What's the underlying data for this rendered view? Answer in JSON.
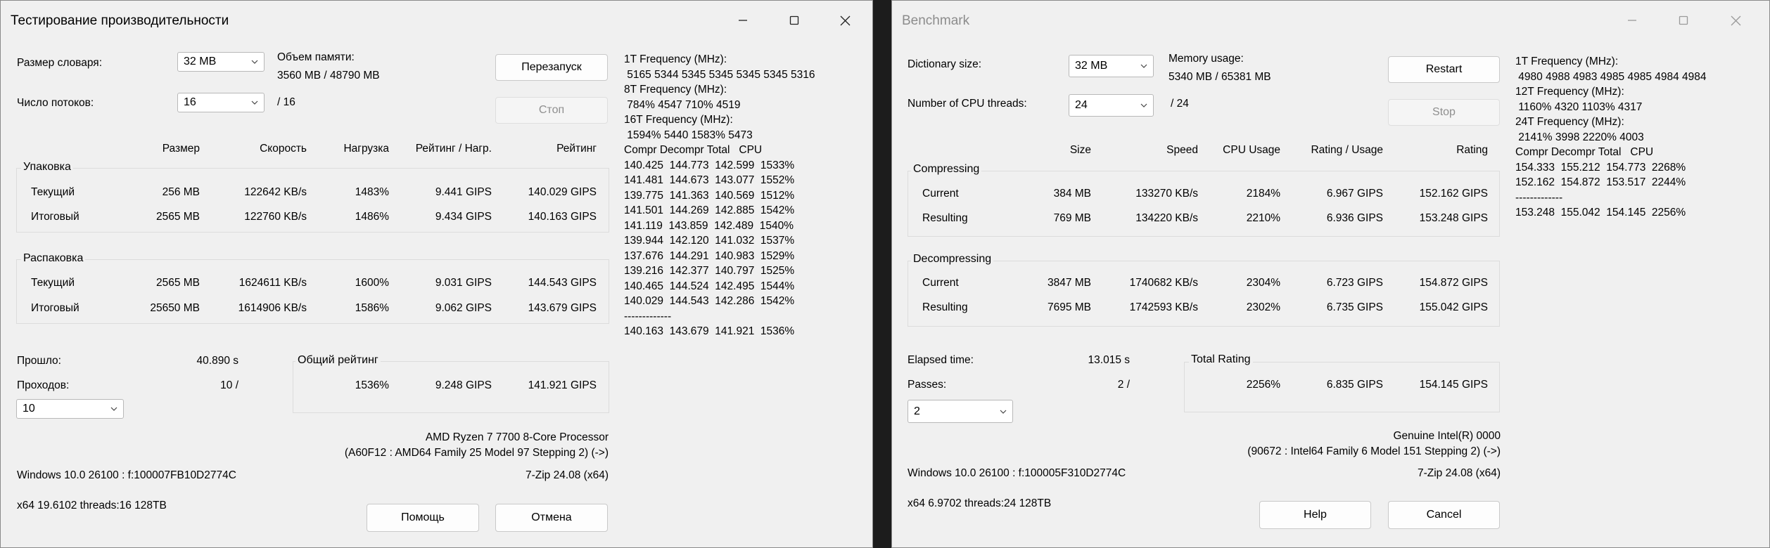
{
  "win1": {
    "title": "Тестирование производительности",
    "dict_label": "Размер словаря:",
    "dict_value": "32 MB",
    "mem_label": "Объем памяти:",
    "mem_value": "3560 MB / 48790 MB",
    "threads_label": "Число потоков:",
    "threads_value": "16",
    "threads_max": "/ 16",
    "restart": "Перезапуск",
    "stop": "Стоп",
    "headers": {
      "size": "Размер",
      "speed": "Скорость",
      "usage": "Нагрузка",
      "rpu": "Рейтинг / Нагр.",
      "rating": "Рейтинг"
    },
    "comp_title": "Упаковка",
    "decomp_title": "Распаковка",
    "comp_rows": [
      {
        "label": "Текущий",
        "size": "256 MB",
        "speed": "122642 KB/s",
        "usage": "1483%",
        "rpu": "9.441 GIPS",
        "rating": "140.029 GIPS"
      },
      {
        "label": "Итоговый",
        "size": "2565 MB",
        "speed": "122760 KB/s",
        "usage": "1486%",
        "rpu": "9.434 GIPS",
        "rating": "140.163 GIPS"
      }
    ],
    "decomp_rows": [
      {
        "label": "Текущий",
        "size": "2565 MB",
        "speed": "1624611 KB/s",
        "usage": "1600%",
        "rpu": "9.031 GIPS",
        "rating": "144.543 GIPS"
      },
      {
        "label": "Итоговый",
        "size": "25650 MB",
        "speed": "1614906 KB/s",
        "usage": "1586%",
        "rpu": "9.062 GIPS",
        "rating": "143.679 GIPS"
      }
    ],
    "elapsed_label": "Прошло:",
    "elapsed_value": "40.890 s",
    "passes_label": "Проходов:",
    "passes_value": "10 /",
    "passes_select": "10",
    "total_title": "Общий рейтинг",
    "total": {
      "usage": "1536%",
      "rpu": "9.248 GIPS",
      "rating": "141.921 GIPS"
    },
    "cpu_name": "AMD Ryzen 7 7700 8-Core Processor",
    "cpu_id": "(A60F12 : AMD64 Family 25 Model 97 Stepping 2) (->)",
    "os": "Windows 10.0 26100 :  f:100007FB10D2774C",
    "version": "7-Zip 24.08 (x64)",
    "arch": "x64 19.6102 threads:16 128TB",
    "help": "Помощь",
    "cancel": "Отмена",
    "side": "1T Frequency (MHz):\n 5165 5344 5345 5345 5345 5345 5316\n8T Frequency (MHz):\n 784% 4547 710% 4519\n16T Frequency (MHz):\n 1594% 5440 1583% 5473\nCompr Decompr Total   CPU\n140.425  144.773  142.599  1533%\n141.481  144.673  143.077  1552%\n139.775  141.363  140.569  1512%\n141.501  144.269  142.885  1542%\n141.119  143.859  142.489  1540%\n139.944  142.120  141.032  1537%\n137.676  144.291  140.983  1529%\n139.216  142.377  140.797  1525%\n140.465  144.524  142.495  1544%\n140.029  144.543  142.286  1542%\n-------------\n140.163  143.679  141.921  1536%"
  },
  "win2": {
    "title": "Benchmark",
    "dict_label": "Dictionary size:",
    "dict_value": "32 MB",
    "mem_label": "Memory usage:",
    "mem_value": "5340 MB / 65381 MB",
    "threads_label": "Number of CPU threads:",
    "threads_value": "24",
    "threads_max": "/ 24",
    "restart": "Restart",
    "stop": "Stop",
    "headers": {
      "size": "Size",
      "speed": "Speed",
      "usage": "CPU Usage",
      "rpu": "Rating / Usage",
      "rating": "Rating"
    },
    "comp_title": "Compressing",
    "decomp_title": "Decompressing",
    "comp_rows": [
      {
        "label": "Current",
        "size": "384 MB",
        "speed": "133270 KB/s",
        "usage": "2184%",
        "rpu": "6.967 GIPS",
        "rating": "152.162 GIPS"
      },
      {
        "label": "Resulting",
        "size": "769 MB",
        "speed": "134220 KB/s",
        "usage": "2210%",
        "rpu": "6.936 GIPS",
        "rating": "153.248 GIPS"
      }
    ],
    "decomp_rows": [
      {
        "label": "Current",
        "size": "3847 MB",
        "speed": "1740682 KB/s",
        "usage": "2304%",
        "rpu": "6.723 GIPS",
        "rating": "154.872 GIPS"
      },
      {
        "label": "Resulting",
        "size": "7695 MB",
        "speed": "1742593 KB/s",
        "usage": "2302%",
        "rpu": "6.735 GIPS",
        "rating": "155.042 GIPS"
      }
    ],
    "elapsed_label": "Elapsed time:",
    "elapsed_value": "13.015 s",
    "passes_label": "Passes:",
    "passes_value": "2 /",
    "passes_select": "2",
    "total_title": "Total Rating",
    "total": {
      "usage": "2256%",
      "rpu": "6.835 GIPS",
      "rating": "154.145 GIPS"
    },
    "cpu_name": "Genuine Intel(R) 0000",
    "cpu_id": "(90672 : Intel64 Family 6 Model 151 Stepping 2) (->)",
    "os": "Windows 10.0 26100 :  f:100005F310D2774C",
    "version": "7-Zip 24.08 (x64)",
    "arch": "x64 6.9702 threads:24 128TB",
    "help": "Help",
    "cancel": "Cancel",
    "side": "1T Frequency (MHz):\n 4980 4988 4983 4985 4985 4984 4984\n12T Frequency (MHz):\n 1160% 4320 1103% 4317\n24T Frequency (MHz):\n 2141% 3998 2220% 4003\nCompr Decompr Total   CPU\n154.333  155.212  154.773  2268%\n152.162  154.872  153.517  2244%\n-------------\n153.248  155.042  154.145  2256%"
  },
  "icons": {
    "minimize": "minimize-icon",
    "maximize": "maximize-icon",
    "close": "close-icon",
    "dropdown": "chevron-down-icon"
  }
}
